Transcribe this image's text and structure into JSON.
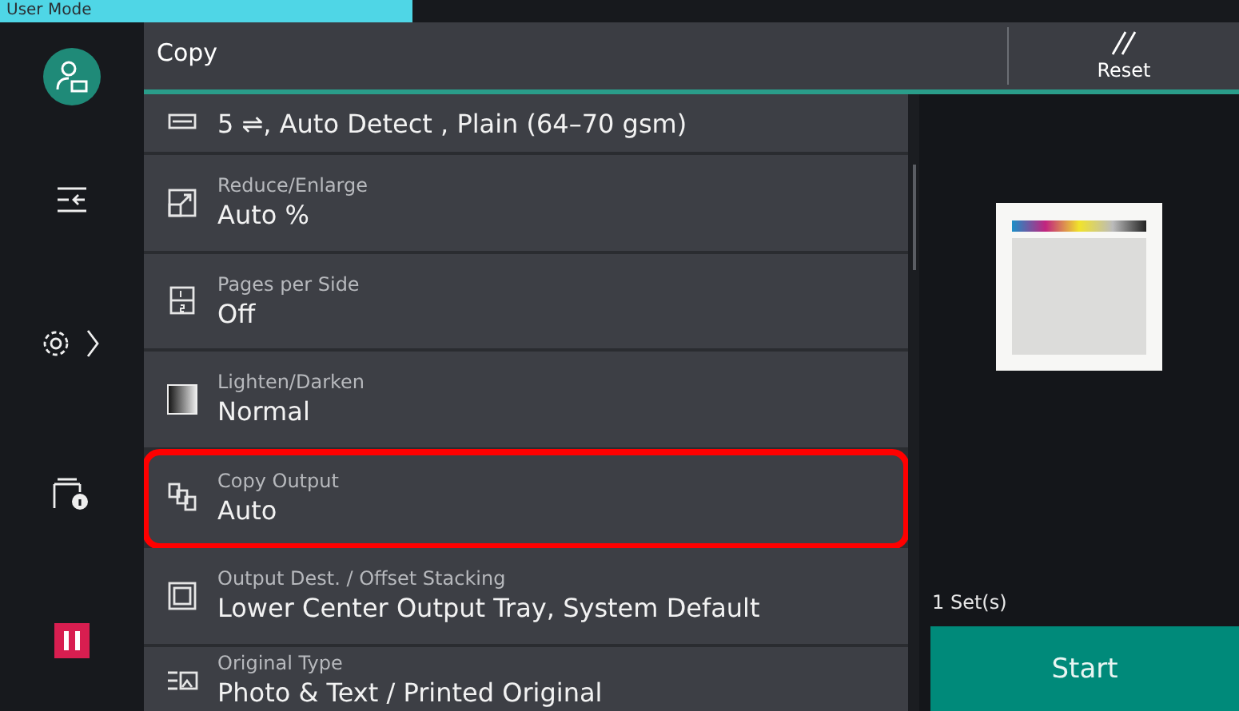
{
  "mode_tab": {
    "label": "User Mode"
  },
  "header": {
    "title": "Copy",
    "reset_button": {
      "label": "Reset"
    }
  },
  "settings": [
    {
      "kind": "paper",
      "value": "5 ⇌, Auto Detect , Plain (64–70 gsm)",
      "highlighted": false
    },
    {
      "kind": "zoom",
      "label": "Reduce/Enlarge",
      "value": "Auto %",
      "highlighted": false
    },
    {
      "kind": "pages",
      "label": "Pages per Side",
      "value": "Off",
      "highlighted": false
    },
    {
      "kind": "density",
      "label": "Lighten/Darken",
      "value": "Normal",
      "highlighted": false
    },
    {
      "kind": "collate",
      "label": "Copy Output",
      "value": "Auto",
      "highlighted": true
    },
    {
      "kind": "tray",
      "label": "Output Dest. / Offset Stacking",
      "value": "Lower Center Output Tray, System Default",
      "highlighted": false
    },
    {
      "kind": "original",
      "label": "Original Type",
      "value": "Photo & Text / Printed Original",
      "highlighted": false
    }
  ],
  "preview": {
    "sets": "1 Set(s)"
  },
  "start_button": {
    "label": "Start"
  }
}
